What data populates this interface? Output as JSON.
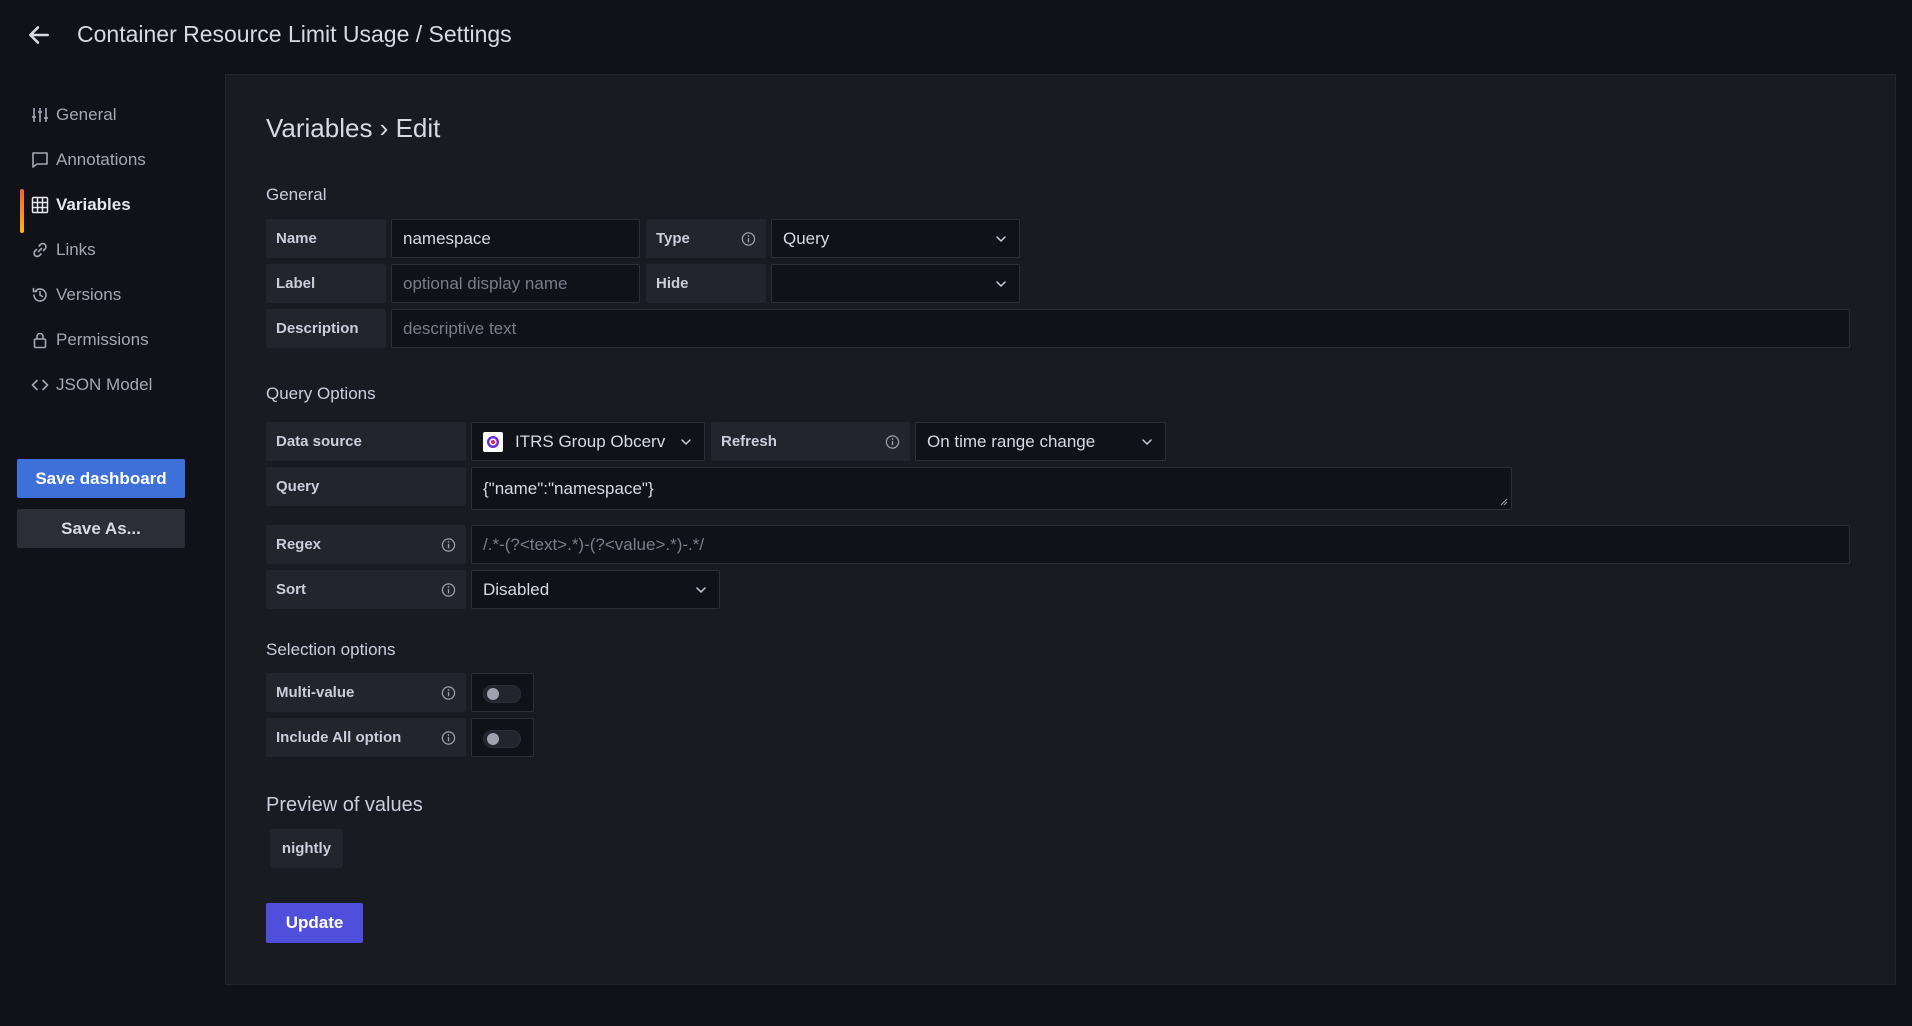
{
  "header": {
    "title": "Container Resource Limit Usage / Settings",
    "back_icon": "arrow-left-icon"
  },
  "sidebar": {
    "items": [
      {
        "label": "General",
        "icon": "sliders-icon"
      },
      {
        "label": "Annotations",
        "icon": "comment-icon"
      },
      {
        "label": "Variables",
        "icon": "calculator-icon",
        "active": true
      },
      {
        "label": "Links",
        "icon": "link-icon"
      },
      {
        "label": "Versions",
        "icon": "history-icon"
      },
      {
        "label": "Permissions",
        "icon": "lock-icon"
      },
      {
        "label": "JSON Model",
        "icon": "code-brackets-icon"
      }
    ],
    "save_dashboard": "Save dashboard",
    "save_as": "Save As..."
  },
  "main": {
    "heading": "Variables › Edit",
    "general": {
      "title": "General",
      "name_label": "Name",
      "name_value": "namespace",
      "type_label": "Type",
      "type_value": "Query",
      "label_label": "Label",
      "label_placeholder": "optional display name",
      "hide_label": "Hide",
      "hide_value": "",
      "description_label": "Description",
      "description_placeholder": "descriptive text"
    },
    "query_options": {
      "title": "Query Options",
      "datasource_label": "Data source",
      "datasource_value": "ITRS Group Obcerv",
      "refresh_label": "Refresh",
      "refresh_value": "On time range change",
      "query_label": "Query",
      "query_value": "{\"name\":\"namespace\"}",
      "regex_label": "Regex",
      "regex_placeholder": "/.*-(?<text>.*)-(?<value>.*)-.*/",
      "sort_label": "Sort",
      "sort_value": "Disabled"
    },
    "selection_options": {
      "title": "Selection options",
      "multi_value_label": "Multi-value",
      "multi_value_on": false,
      "include_all_label": "Include All option",
      "include_all_on": false
    },
    "preview": {
      "title": "Preview of values",
      "values": [
        "nightly"
      ]
    },
    "update_button": "Update"
  },
  "colors": {
    "primary_button": "#3d71d9",
    "update_button": "#4f4fdc",
    "active_indicator_top": "#f55f3e",
    "active_indicator_bottom": "#ffb800"
  }
}
